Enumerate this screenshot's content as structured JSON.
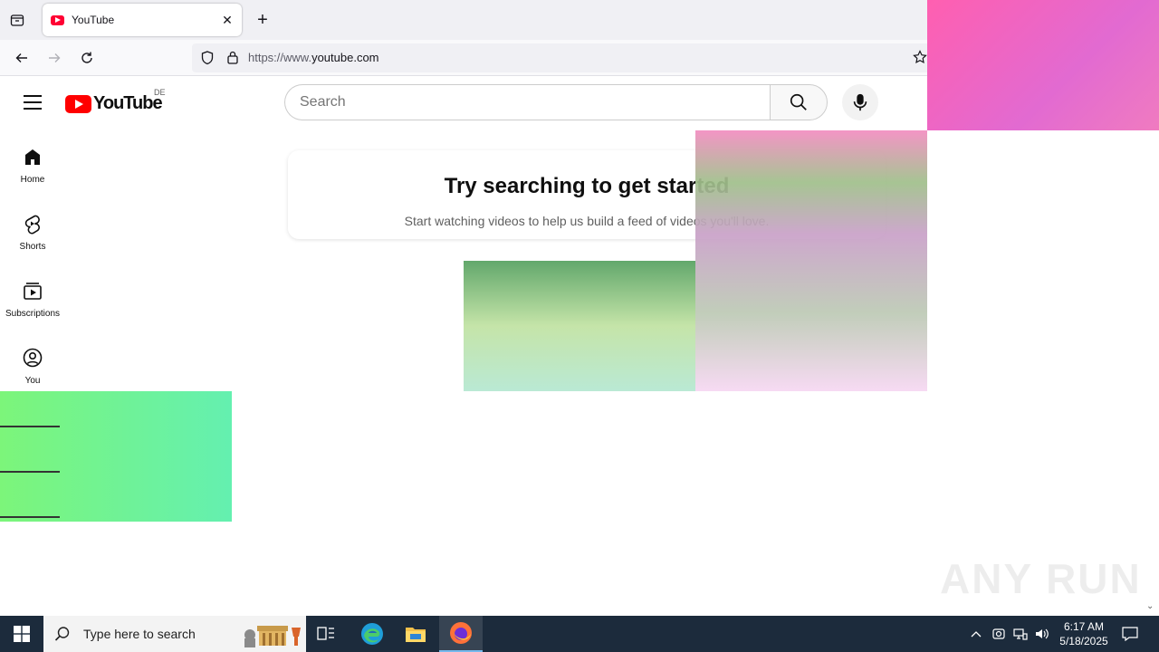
{
  "browser": {
    "tab_title": "YouTube",
    "new_tab_label": "+",
    "url_prefix": "https://www.",
    "url_host": "youtube.com"
  },
  "youtube": {
    "logo_text": "YouTube",
    "country_code": "DE",
    "search_placeholder": "Search",
    "guide": [
      {
        "label": "Home",
        "icon": "home-icon"
      },
      {
        "label": "Shorts",
        "icon": "shorts-icon"
      },
      {
        "label": "Subscriptions",
        "icon": "subscriptions-icon"
      },
      {
        "label": "You",
        "icon": "you-icon"
      }
    ],
    "feed_prompt": {
      "heading": "Try searching to get started",
      "subtext": "Start watching videos to help us build a feed of videos you'll love."
    }
  },
  "watermark": "ANY RUN",
  "taskbar": {
    "search_placeholder": "Type here to search",
    "time": "6:17 AM",
    "date": "5/18/2025"
  },
  "colors": {
    "youtube_red": "#ff0000",
    "taskbar_bg": "#1c2b3c"
  }
}
